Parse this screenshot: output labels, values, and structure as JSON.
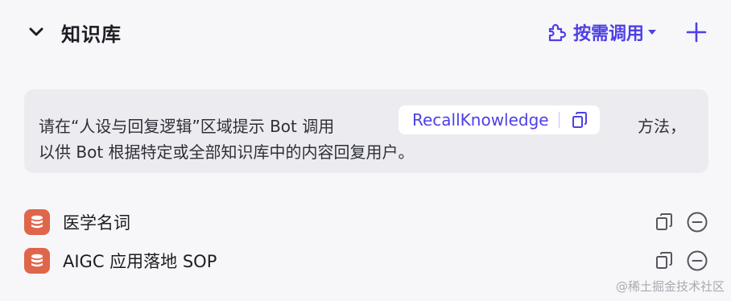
{
  "header": {
    "title": "知识库",
    "mode_label": "按需调用",
    "collapse_icon": "chevron-down-icon",
    "add_icon": "plus-icon",
    "accent_color": "#4e40e5"
  },
  "info": {
    "line1_prefix": "请在“人设与回复逻辑”区域提示 Bot 调用",
    "method_name": "RecallKnowledge",
    "line1_suffix": "方法，",
    "line2": "以供 Bot 根据特定或全部知识库中的内容回复用户。"
  },
  "knowledge_items": [
    {
      "name": "医学名词",
      "icon": "database-icon"
    },
    {
      "name": "AIGC 应用落地 SOP",
      "icon": "database-icon"
    }
  ],
  "watermark": "@稀土掘金技术社区"
}
